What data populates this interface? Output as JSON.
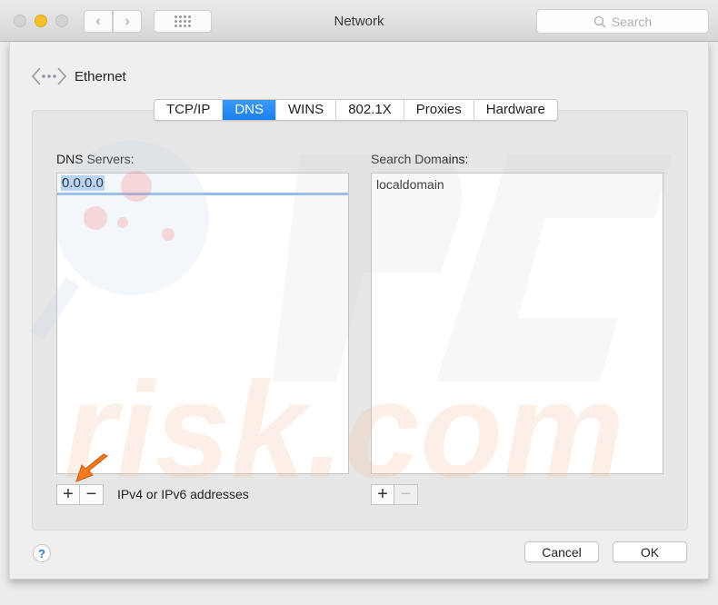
{
  "window": {
    "title": "Network",
    "search_placeholder": "Search"
  },
  "header": {
    "interface_name": "Ethernet"
  },
  "tabs": [
    {
      "label": "TCP/IP",
      "active": false
    },
    {
      "label": "DNS",
      "active": true
    },
    {
      "label": "WINS",
      "active": false
    },
    {
      "label": "802.1X",
      "active": false
    },
    {
      "label": "Proxies",
      "active": false
    },
    {
      "label": "Hardware",
      "active": false
    }
  ],
  "dns_servers": {
    "label": "DNS Servers:",
    "entries": [
      "0.0.0.0"
    ],
    "hint": "IPv4 or IPv6 addresses",
    "add_label": "+",
    "remove_label": "−"
  },
  "search_domains": {
    "label": "Search Domains:",
    "entries": [
      "localdomain"
    ],
    "add_label": "+",
    "remove_label": "−"
  },
  "footer": {
    "help_label": "?",
    "cancel_label": "Cancel",
    "ok_label": "OK"
  },
  "watermark": "PCrisk.com",
  "colors": {
    "accent": "#1a7ff0",
    "selection": "#b5d4f8",
    "annotation_arrow": "#f47920"
  }
}
